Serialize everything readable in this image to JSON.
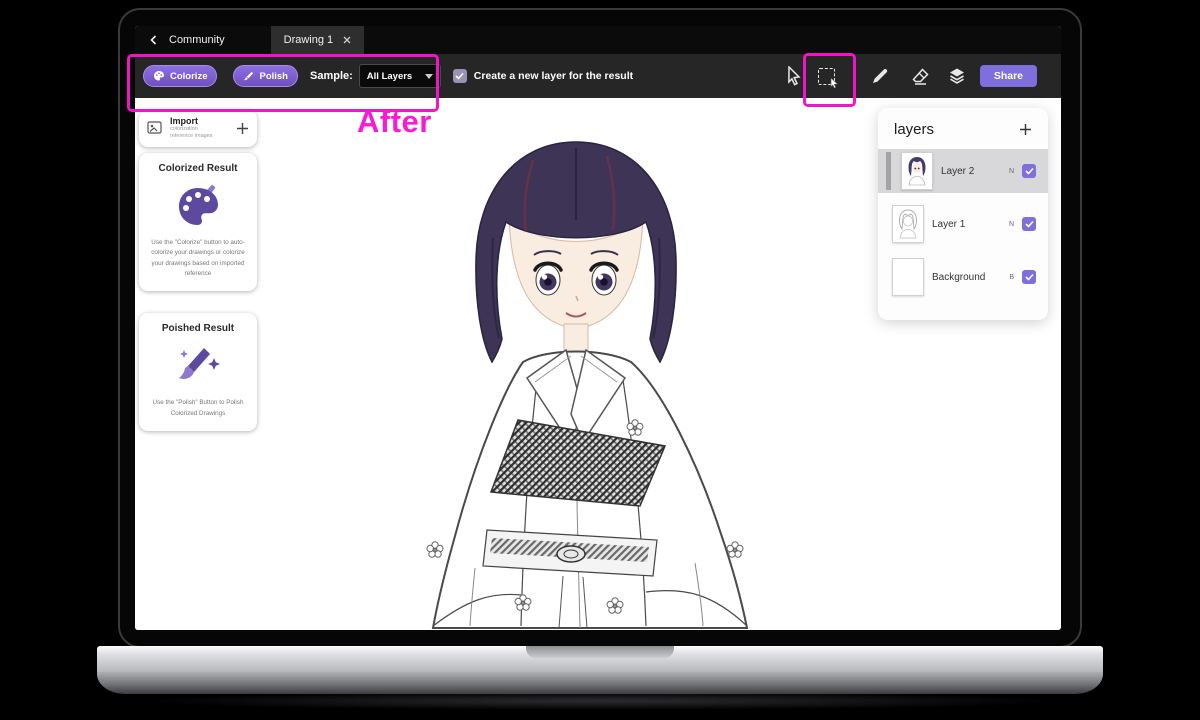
{
  "topbar": {
    "back_label": "Community",
    "tab_title": "Drawing 1"
  },
  "toolbar": {
    "colorize": "Colorize",
    "polish": "Polish",
    "sample_label": "Sample:",
    "sample_value": "All Layers",
    "new_layer_label": "Create a new layer for the result",
    "share": "Share"
  },
  "left_panel": {
    "import": {
      "title": "Import",
      "subtitle": "colorization reference images"
    },
    "colorized": {
      "title": "Colorized Result",
      "description": "Use the \"Colorize\" button to auto-colorize your drawings or colorize your drawings based on imported reference"
    },
    "polished": {
      "title": "Poished Result",
      "description": "Use the \"Polish\" Button to Polish Colorized Drawings"
    }
  },
  "layers_panel": {
    "title": "layers",
    "rows": [
      {
        "name": "Layer 2",
        "badge": "N",
        "selected": true
      },
      {
        "name": "Layer 1",
        "badge": "N",
        "selected": false
      },
      {
        "name": "Background",
        "badge": "B",
        "selected": false
      }
    ]
  },
  "annotation": {
    "label": "After"
  },
  "colors": {
    "accent": "#7e6ede",
    "annotation": "#ef16c5",
    "hair": "#3d3456"
  }
}
